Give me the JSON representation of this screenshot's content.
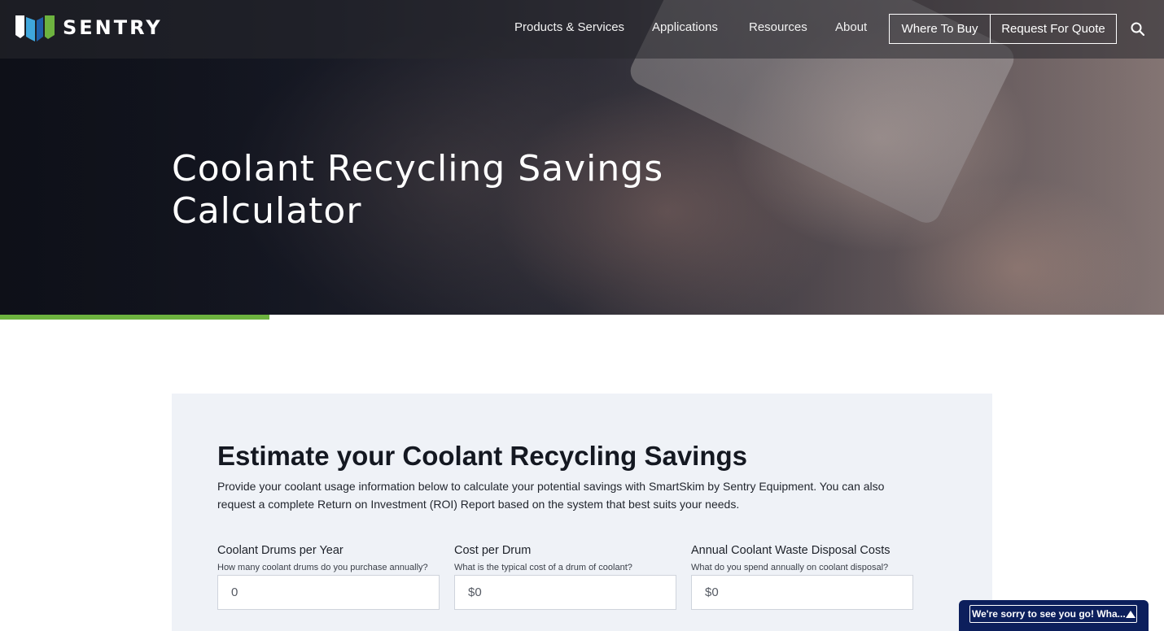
{
  "brand": {
    "name": "SENTRY",
    "accent": "#6db33f",
    "blue_dark": "#1e5ea8",
    "blue_light": "#3fa6dc"
  },
  "nav": {
    "items": [
      {
        "label": "Products & Services"
      },
      {
        "label": "Applications"
      },
      {
        "label": "Resources"
      },
      {
        "label": "About"
      }
    ],
    "where_to_buy": "Where To Buy",
    "request_quote": "Request For Quote",
    "search_icon": "search-icon"
  },
  "hero": {
    "title_line1": "Coolant Recycling Savings",
    "title_line2": "Calculator"
  },
  "calculator": {
    "title": "Estimate your Coolant Recycling Savings",
    "description": "Provide your coolant usage information below to calculate your potential savings with SmartSkim by Sentry Equipment. You can also request a complete Return on Investment (ROI) Report based on the system that best suits your needs.",
    "fields": [
      {
        "label": "Coolant Drums per Year",
        "help": "How many coolant drums do you purchase annually?",
        "value": "0"
      },
      {
        "label": "Cost per Drum",
        "help": "What is the typical cost of a drum of coolant?",
        "value": "$0"
      },
      {
        "label": "Annual Coolant Waste Disposal Costs",
        "help": "What do you spend annually on coolant disposal?",
        "value": "$0"
      }
    ]
  },
  "feedback": {
    "label": "We're sorry to see you go! Wha...",
    "icon": "caret-up-icon"
  }
}
